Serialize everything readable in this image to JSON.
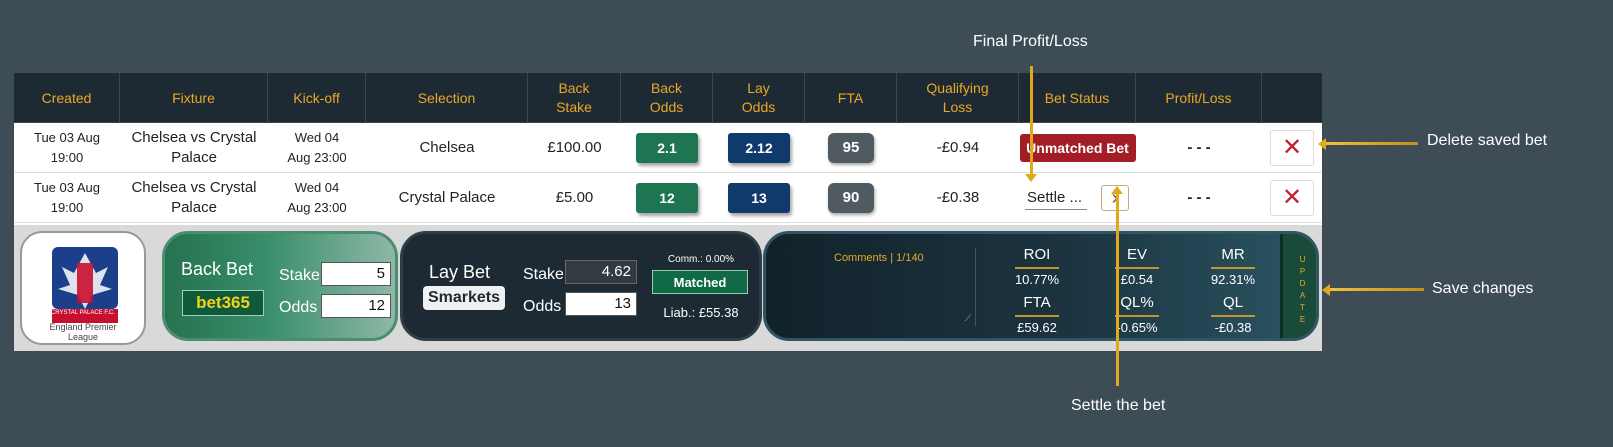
{
  "header": {
    "created": "Created",
    "fixture": "Fixture",
    "kickoff": "Kick-off",
    "selection": "Selection",
    "back_stake": [
      "Back",
      "Stake"
    ],
    "back_odds": [
      "Back",
      "Odds"
    ],
    "lay_odds": [
      "Lay",
      "Odds"
    ],
    "fta": "FTA",
    "qualifying_loss": [
      "Qualifying",
      "Loss"
    ],
    "bet_status": "Bet Status",
    "profit_loss": "Profit/Loss"
  },
  "rows": [
    {
      "created": [
        "Tue 03 Aug",
        "19:00"
      ],
      "fixture": [
        "Chelsea vs Crystal",
        "Palace"
      ],
      "kickoff": [
        "Wed 04",
        "Aug 23:00"
      ],
      "selection": "Chelsea",
      "back_stake": "£100.00",
      "back_odds": "2.1",
      "lay_odds": "2.12",
      "fta": "95",
      "qualifying_loss": "-£0.94",
      "bet_status": "Unmatched Bet",
      "profit_loss": "- - -",
      "delete": "✕"
    },
    {
      "created": [
        "Tue 03 Aug",
        "19:00"
      ],
      "fixture": [
        "Chelsea vs Crystal",
        "Palace"
      ],
      "kickoff": [
        "Wed 04",
        "Aug 23:00"
      ],
      "selection": "Crystal Palace",
      "back_stake": "£5.00",
      "back_odds": "12",
      "lay_odds": "13",
      "fta": "90",
      "qualifying_loss": "-£0.38",
      "bet_status_select": "Settle ...",
      "settle_arrow": "›",
      "profit_loss": "- - -",
      "delete": "✕"
    }
  ],
  "detail": {
    "crest_text": [
      "CRYSTAL PALACE F.C.",
      "England Premier",
      "League"
    ],
    "back": {
      "title": "Back Bet",
      "bookmaker": "bet365",
      "stake_label": "Stake",
      "stake": "5",
      "odds_label": "Odds",
      "odds": "12"
    },
    "lay": {
      "title": "Lay Bet",
      "exchange": "Smarkets",
      "stake_label": "Stake",
      "stake": "4.62",
      "odds_label": "Odds",
      "odds": "13",
      "commission": "Comm.: 0.00%",
      "status": "Matched",
      "liability": "Liab.: £55.38"
    },
    "comments": "Comments | 1/140",
    "metrics": {
      "roi_label": "ROI",
      "roi": "10.77%",
      "ev_label": "EV",
      "ev": "£0.54",
      "mr_label": "MR",
      "mr": "92.31%",
      "fta_label": "FTA",
      "fta": "£59.62",
      "ql_pct_label": "QL%",
      "ql_pct": "-0.65%",
      "ql_label": "QL",
      "ql": "-£0.38"
    },
    "update_label": [
      "U",
      "P",
      "D",
      "A",
      "T",
      "E"
    ]
  },
  "annotations": {
    "final_profit": "Final Profit/Loss",
    "delete": "Delete saved bet",
    "save": "Save changes",
    "settle": "Settle the bet"
  },
  "colors": {
    "background": "#3e4c56",
    "header": "#1d2a33",
    "accent": "#e9a825",
    "back_green": "#1d7552",
    "lay_blue": "#0f3a6b",
    "unmatched_red": "#a31d25"
  }
}
